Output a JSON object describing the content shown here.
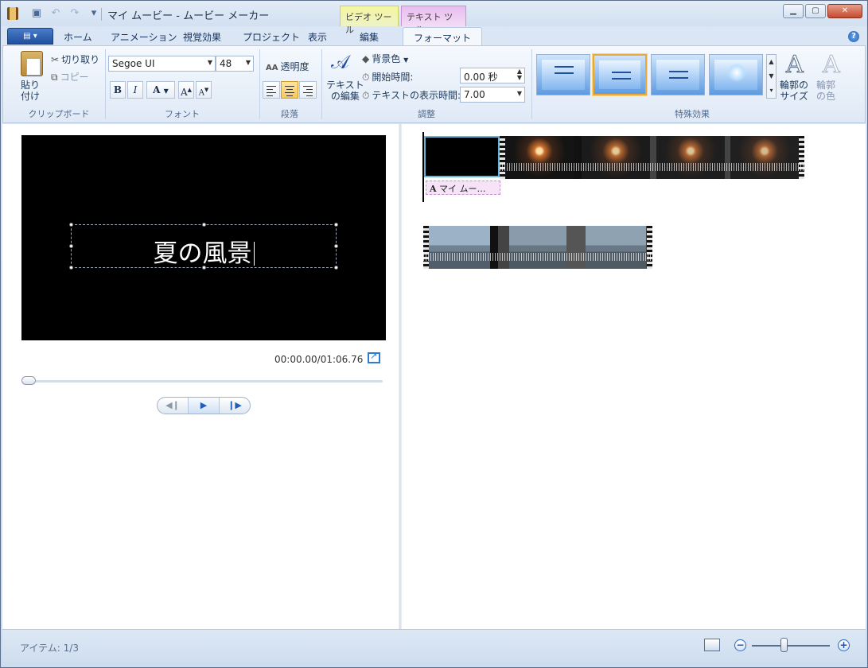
{
  "window": {
    "title": "マイ ムービー - ムービー メーカー",
    "context_tabs": {
      "video_tools": "ビデオ ツール",
      "text_tools": "テキスト ツール"
    }
  },
  "ribbon_tabs": [
    "ホーム",
    "アニメーション",
    "視覚効果",
    "プロジェクト",
    "表示",
    "編集",
    "フォーマット"
  ],
  "active_tab": "フォーマット",
  "clipboard": {
    "paste": "貼り\n付け",
    "cut": "切り取り",
    "copy": "コピー",
    "group": "クリップボード"
  },
  "font": {
    "family": "Segoe UI",
    "size": "48",
    "bold": "B",
    "italic": "I",
    "color": "A",
    "grow": "A",
    "shrink": "A",
    "group": "フォント"
  },
  "paragraph": {
    "transparency": "透明度",
    "alignment_selected": "center",
    "group": "段落"
  },
  "adjust": {
    "edit_text": "テキスト\nの編集",
    "background_color": "背景色",
    "start_time_label": "開始時間:",
    "start_time_value": "0.00 秒",
    "duration_label": "テキストの表示時間:",
    "duration_value": "7.00",
    "group": "調整"
  },
  "effects": {
    "group": "特殊効果",
    "selected_index": 1,
    "outline_size": "輪郭の\nサイズ",
    "outline_color": "輪郭\nの色"
  },
  "preview": {
    "caption_text": "夏の風景",
    "time_readout": "00:00.00/01:06.76"
  },
  "storyboard": {
    "text_overlay_label": "マイ ムー…",
    "overlay_icon": "A"
  },
  "status": {
    "items_text": "アイテム: 1/3"
  },
  "colors": {
    "accent": "#1f5fb7",
    "context_video": "#f4f6a0",
    "context_text": "#e9bdf0",
    "selected_effect": "#e8a93a"
  }
}
